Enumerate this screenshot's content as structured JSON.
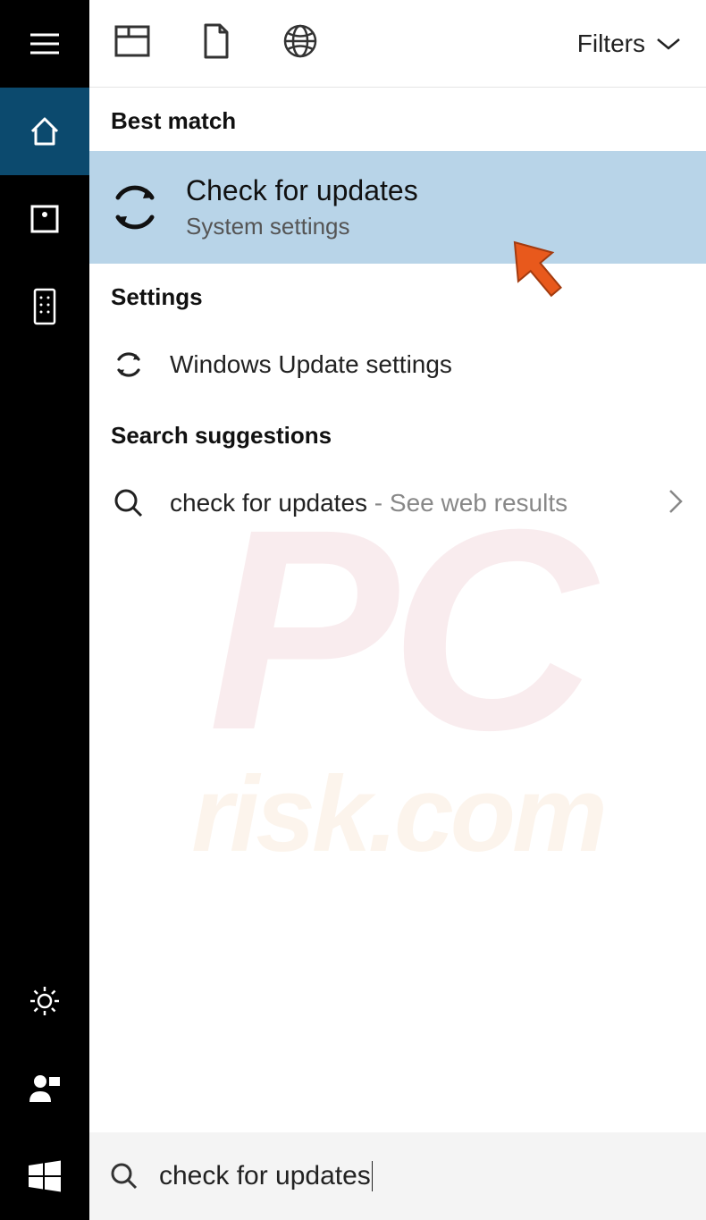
{
  "toolbar": {
    "filters_label": "Filters"
  },
  "sections": {
    "best_match": "Best match",
    "settings": "Settings",
    "suggestions": "Search suggestions"
  },
  "best_match": {
    "title": "Check for updates",
    "subtitle": "System settings"
  },
  "settings_results": [
    {
      "label": "Windows Update settings"
    }
  ],
  "suggestions": [
    {
      "label": "check for updates",
      "suffix": " - See web results"
    }
  ],
  "search": {
    "value": "check for updates"
  },
  "watermark": {
    "line1": "PC",
    "line2": "risk.com"
  }
}
